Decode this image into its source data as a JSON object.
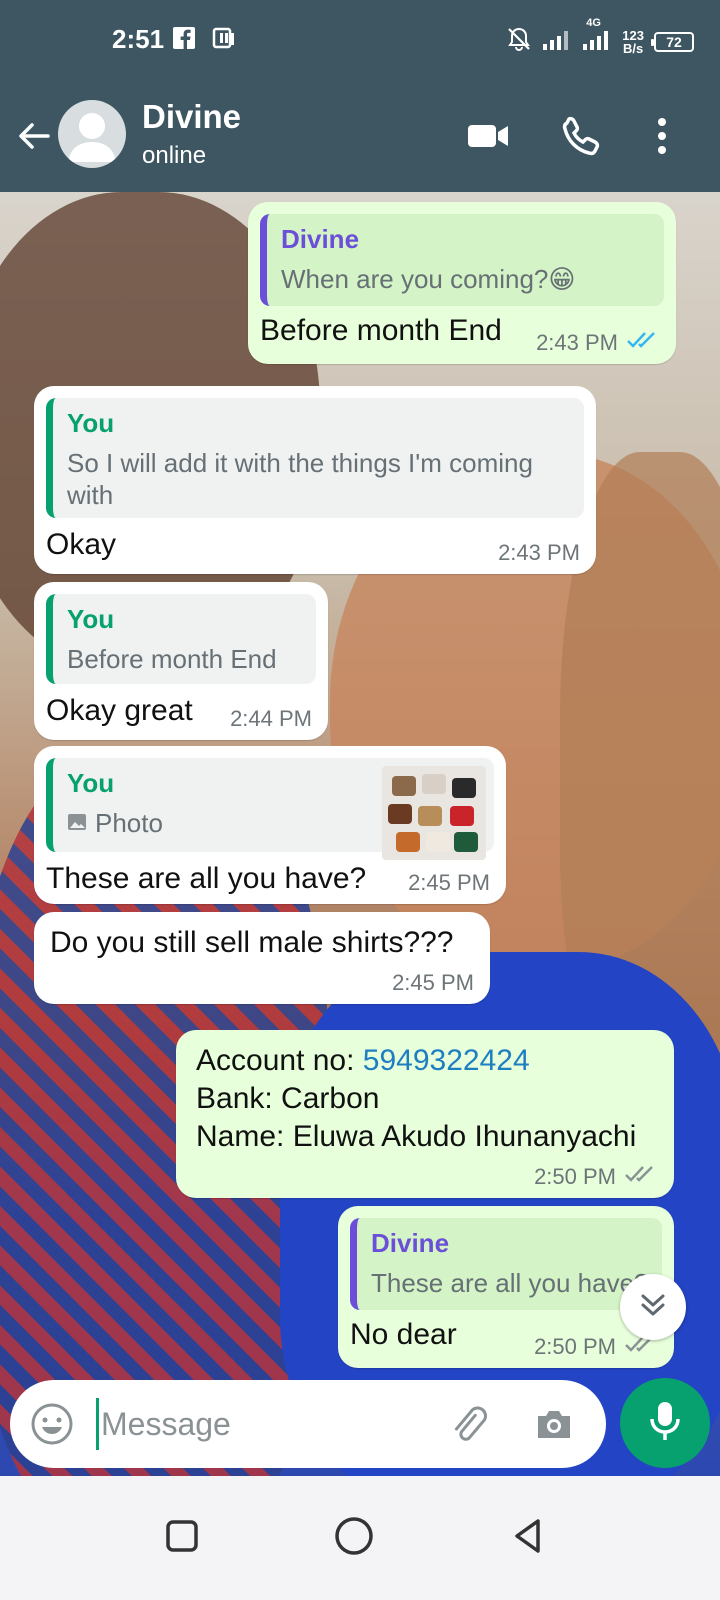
{
  "status_bar": {
    "time": "2:51",
    "network": "4G",
    "speed_value": "123",
    "speed_unit": "B/s",
    "battery": "72"
  },
  "header": {
    "contact_name": "Divine",
    "contact_status": "online"
  },
  "messages": [
    {
      "direction": "out",
      "quote_author": "Divine",
      "quote_text": "When are you coming?😁",
      "text": "Before month End",
      "time": "2:43 PM",
      "read": true
    },
    {
      "direction": "in",
      "quote_author": "You",
      "quote_text": "So I will add it with the things I'm coming with",
      "text": "Okay",
      "time": "2:43 PM"
    },
    {
      "direction": "in",
      "quote_author": "You",
      "quote_text": "Before month End",
      "text": "Okay great",
      "time": "2:44 PM"
    },
    {
      "direction": "in",
      "quote_author": "You",
      "quote_text": "Photo",
      "text": "These are all you have?",
      "time": "2:45 PM"
    },
    {
      "direction": "in",
      "text": "Do you still sell male shirts???",
      "time": "2:45 PM"
    },
    {
      "direction": "out",
      "line1_label": "Account no: ",
      "account_no": "5949322424",
      "line2": "Bank: Carbon",
      "line3": "Name: Eluwa Akudo Ihunanyachi",
      "time": "2:50 PM",
      "read": false
    },
    {
      "direction": "out",
      "quote_author": "Divine",
      "quote_text": "These are all you have?",
      "text": "No dear",
      "time": "2:50 PM",
      "read": false
    }
  ],
  "input": {
    "placeholder": "Message"
  },
  "colors": {
    "header": "#3d5661",
    "accent": "#06a16e",
    "read_tick": "#34b7f1",
    "out_bubble": "#e7ffdb"
  }
}
